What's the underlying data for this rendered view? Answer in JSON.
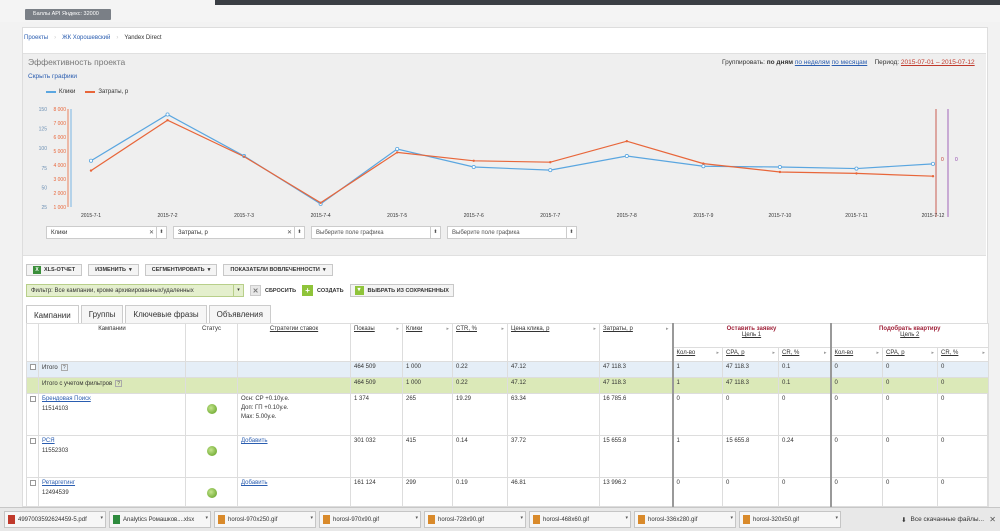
{
  "topbar": {
    "badge": "Баллы API Яндекс: 32000"
  },
  "breadcrumb": {
    "items": [
      "Проекты",
      "ЖК Хорошевский",
      "Yandex Direct"
    ]
  },
  "panel": {
    "title": "Эффективность проекта",
    "hide_link": "Скрыть графики",
    "group_label": "Группировать:",
    "group_days": "по дням",
    "group_weeks": "по неделям",
    "group_months": "по месяцам",
    "period_label": "Период:",
    "period_value": "2015-07-01 – 2015-07-12"
  },
  "colors": {
    "clicks": "#5aa6e0",
    "cost": "#e8663a",
    "accent_right": "#c0392b",
    "purple": "#8e44ad"
  },
  "chart_data": {
    "type": "line",
    "x": [
      "2015-7-1",
      "2015-7-2",
      "2015-7-3",
      "2015-7-4",
      "2015-7-5",
      "2015-7-6",
      "2015-7-7",
      "2015-7-8",
      "2015-7-9",
      "2015-7-10",
      "2015-7-11",
      "2015-7-12"
    ],
    "series": [
      {
        "name": "Клики",
        "axis": "left_inner",
        "values": [
          84,
          143,
          90,
          29,
          99,
          76,
          72,
          90,
          77,
          76,
          74,
          80
        ]
      },
      {
        "name": "Затраты, р",
        "axis": "left_outer",
        "values": [
          3600,
          7200,
          4600,
          1300,
          4900,
          4300,
          4200,
          5700,
          4100,
          3500,
          3400,
          3200
        ]
      }
    ],
    "left_inner_ticks": [
      "150",
      "125",
      "100",
      "75",
      "50",
      "25"
    ],
    "left_outer_ticks": [
      "8 000",
      "7 000",
      "6 000",
      "5 000",
      "4 000",
      "3 000",
      "2 000",
      "1 000"
    ],
    "right_ticks": [
      "0",
      "0"
    ],
    "ylim_inner": [
      25,
      150
    ],
    "ylim_outer": [
      1000,
      8000
    ],
    "legend": "top-left",
    "grid": false
  },
  "selectors": [
    {
      "label": "Клики"
    },
    {
      "label": "Затраты, р"
    },
    {
      "label": "Выберите поле графика"
    },
    {
      "label": "Выберите поле графика"
    }
  ],
  "toolbar": {
    "xls": "XLS-ОТЧЕТ",
    "change": "ИЗМЕНИТЬ",
    "segment": "СЕГМЕНТИРОВАТЬ",
    "engagement": "ПОКАЗАТЕЛИ ВОВЛЕЧЕННОСТИ"
  },
  "filter": {
    "value": "Фильтр: Все кампании, кроме архивированных/удаленных",
    "reset": "СБРОСИТЬ",
    "create": "СОЗДАТЬ",
    "pick": "ВЫБРАТЬ ИЗ СОХРАНЕННЫХ"
  },
  "tabs": [
    "Кампании",
    "Группы",
    "Ключевые фразы",
    "Объявления"
  ],
  "table": {
    "h": {
      "campaigns": "Кампании",
      "status": "Статус",
      "strategies": "Стратегии ставок",
      "shows": "Показы",
      "clicks": "Клики",
      "ctr": "CTR, %",
      "cpc": "Цена клика, р",
      "cost": "Затраты, р",
      "goal1": "Оставить заявку",
      "goal1sub": "Цель 1",
      "goal2": "Подобрать квартиру",
      "goal2sub": "Цель 2",
      "cnt": "Кол-во",
      "cpa": "CPA, р",
      "cr": "CR, %"
    },
    "total": {
      "label": "Итого",
      "q": "?",
      "shows": "464 509",
      "clicks": "1 000",
      "ctr": "0.22",
      "cpc": "47.12",
      "cost": "47 118.3",
      "g1cnt": "1",
      "g1cpa": "47 118.3",
      "g1cr": "0.1",
      "g2cnt": "0",
      "g2cpa": "0",
      "g2cr": "0"
    },
    "totalf": {
      "label": "Итого с учетом фильтров",
      "q": "?",
      "shows": "464 509",
      "clicks": "1 000",
      "ctr": "0.22",
      "cpc": "47.12",
      "cost": "47 118.3",
      "g1cnt": "1",
      "g1cpa": "47 118.3",
      "g1cr": "0.1",
      "g2cnt": "0",
      "g2cpa": "0",
      "g2cr": "0"
    },
    "rows": [
      {
        "name": "Брендовая Поиск",
        "id": "11514103",
        "strat1": "Осн: CP +0.10у.е.",
        "strat2": "Доп: ГП +0.10у.е.",
        "strat3": "Мах: 5.00у.е.",
        "shows": "1 374",
        "clicks": "265",
        "ctr": "19.29",
        "cpc": "63.34",
        "cost": "16 785.6",
        "g1cnt": "0",
        "g1cpa": "0",
        "g1cr": "0",
        "g2cnt": "0",
        "g2cpa": "0",
        "g2cr": "0"
      },
      {
        "name": "РСЯ",
        "id": "11552303",
        "strat1": "Добавить",
        "shows": "301 032",
        "clicks": "415",
        "ctr": "0.14",
        "cpc": "37.72",
        "cost": "15 655.8",
        "g1cnt": "1",
        "g1cpa": "15 655.8",
        "g1cr": "0.24",
        "g2cnt": "0",
        "g2cpa": "0",
        "g2cr": "0"
      },
      {
        "name": "Ретаргетинг",
        "id": "12494539",
        "strat1": "Добавить",
        "shows": "161 124",
        "clicks": "299",
        "ctr": "0.19",
        "cpc": "46.81",
        "cost": "13 996.2",
        "g1cnt": "0",
        "g1cpa": "0",
        "g1cr": "0",
        "g2cnt": "0",
        "g2cpa": "0",
        "g2cr": "0"
      }
    ]
  },
  "downloads": {
    "items": [
      "4997003592624459-5.pdf",
      "Analytics Ромашков....xlsx",
      "horosl-970x250.gif",
      "horosl-970x90.gif",
      "horosl-728x90.gif",
      "horosl-468x60.gif",
      "horosl-336x280.gif",
      "horosl-320x50.gif"
    ],
    "all": "Все скачанные файлы..."
  }
}
